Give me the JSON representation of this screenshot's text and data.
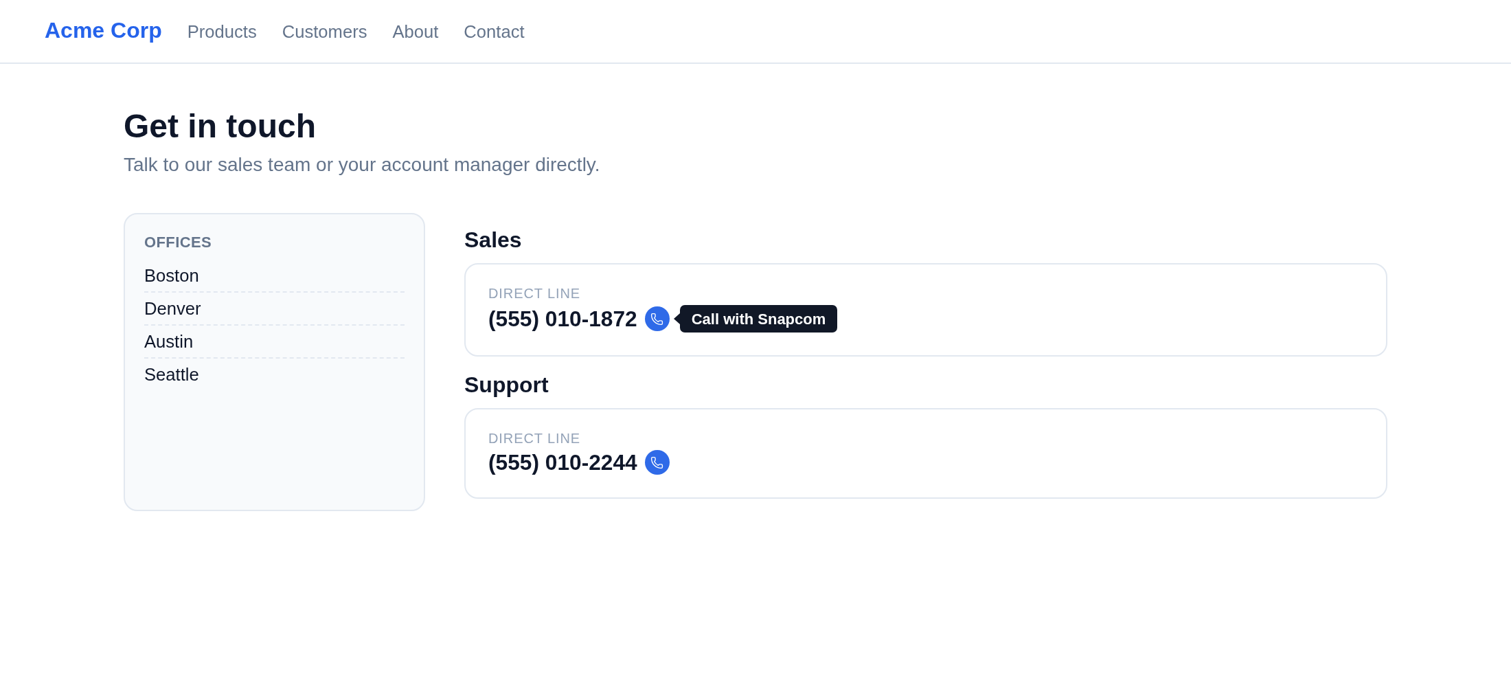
{
  "nav": {
    "logo": "Acme Corp",
    "links": [
      {
        "label": "Products"
      },
      {
        "label": "Customers"
      },
      {
        "label": "About"
      },
      {
        "label": "Contact"
      }
    ]
  },
  "page": {
    "title": "Get in touch",
    "subtitle": "Talk to our sales team or your account manager directly."
  },
  "offices": {
    "title": "OFFICES",
    "items": [
      "Boston",
      "Denver",
      "Austin",
      "Seattle"
    ]
  },
  "contacts": [
    {
      "heading": "Sales",
      "label": "DIRECT LINE",
      "phone": "(555) 010-1872",
      "tooltip": "Call with Snapcom"
    },
    {
      "heading": "Support",
      "label": "DIRECT LINE",
      "phone": "(555) 010-2244"
    }
  ]
}
